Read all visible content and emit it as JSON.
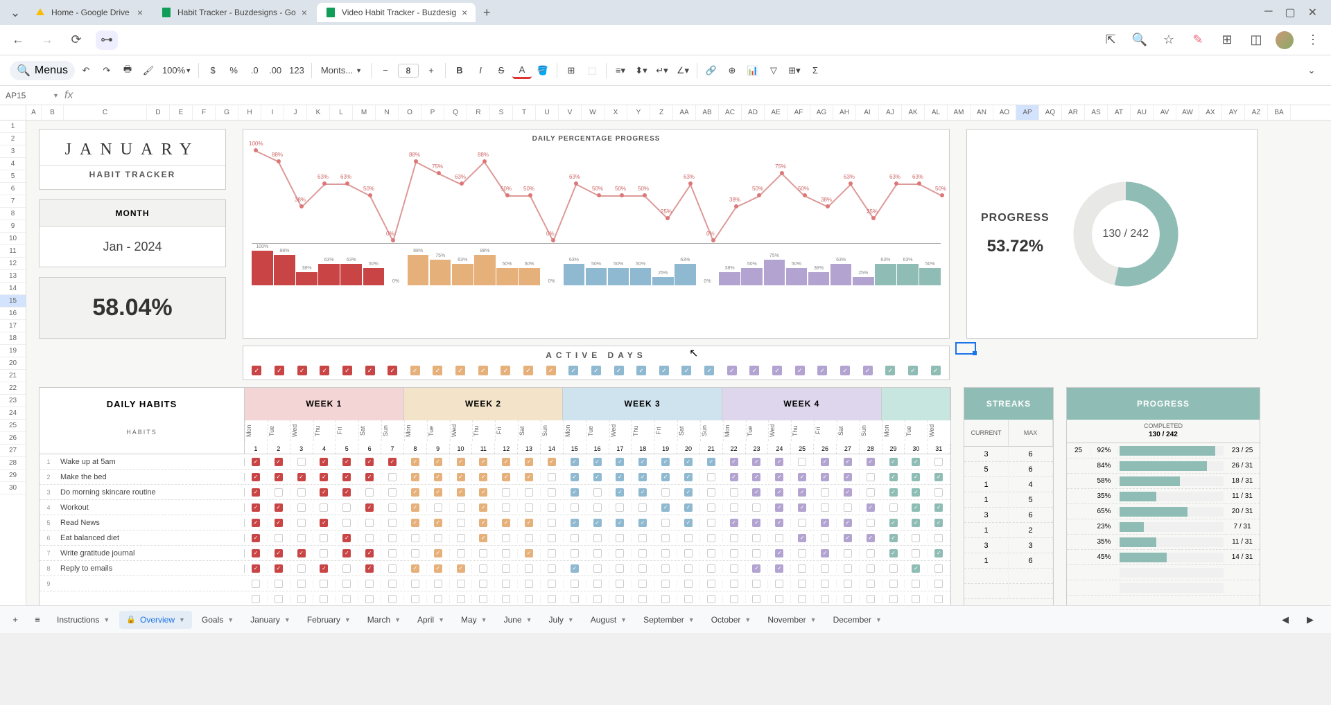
{
  "browser": {
    "tabs": [
      {
        "title": "Home - Google Drive",
        "icon": "drive"
      },
      {
        "title": "Habit Tracker - Buzdesigns - Go",
        "icon": "sheets"
      },
      {
        "title": "Video Habit Tracker - Buzdesig",
        "icon": "sheets",
        "active": true
      }
    ]
  },
  "toolbar": {
    "menus_label": "Menus",
    "zoom": "100%",
    "font": "Monts...",
    "font_size": "8",
    "formats": [
      "$",
      "%",
      ".0",
      ".00",
      "123"
    ]
  },
  "formula_bar": {
    "cell_ref": "AP15",
    "fx": "fx"
  },
  "columns": [
    "A",
    "B",
    "C",
    "D",
    "E",
    "F",
    "G",
    "H",
    "I",
    "J",
    "K",
    "L",
    "M",
    "N",
    "O",
    "P",
    "Q",
    "R",
    "S",
    "T",
    "U",
    "V",
    "W",
    "X",
    "Y",
    "Z",
    "AA",
    "AB",
    "AC",
    "AD",
    "AE",
    "AF",
    "AG",
    "AH",
    "AI",
    "AJ",
    "AK",
    "AL",
    "AM",
    "AN",
    "AO",
    "AP",
    "AQ",
    "AR",
    "AS",
    "AT",
    "AU",
    "AV",
    "AW",
    "AX",
    "AY",
    "AZ",
    "BA"
  ],
  "rows_count": 30,
  "selected_row": 15,
  "selected_col": "AP",
  "month_card": {
    "title": "JANUARY",
    "subtitle": "HABIT TRACKER"
  },
  "month_select": {
    "label": "MONTH",
    "value": "Jan  -  2024"
  },
  "month_pct": "58.04%",
  "chart_data": {
    "type": "line+bar",
    "title": "DAILY PERCENTAGE PROGRESS",
    "series": [
      {
        "name": "daily_pct",
        "values": [
          100,
          88,
          38,
          63,
          63,
          50,
          0,
          88,
          75,
          63,
          88,
          50,
          50,
          0,
          63,
          50,
          50,
          50,
          25,
          63,
          0,
          38,
          50,
          75,
          50,
          38,
          63,
          25,
          63,
          63,
          50
        ]
      }
    ],
    "week_colors": [
      "#c94545",
      "#e6b07a",
      "#8fb8d1",
      "#b3a3d1",
      "#8fbdb5"
    ]
  },
  "progress_card": {
    "label": "PROGRESS",
    "pct": "53.72%",
    "fraction": "130 / 242",
    "donut_pct": 53.72
  },
  "active_days": {
    "title": "ACTIVE DAYS",
    "count": 31
  },
  "habits_table": {
    "title": "DAILY HABITS",
    "habits_label": "HABITS",
    "weeks": [
      "WEEK 1",
      "WEEK 2",
      "WEEK 3",
      "WEEK 4",
      ""
    ],
    "days": [
      "Mon",
      "Tue",
      "Wed",
      "Thu",
      "Fri",
      "Sat",
      "Sun",
      "Mon",
      "Tue",
      "Wed",
      "Thu",
      "Fri",
      "Sat",
      "Sun",
      "Mon",
      "Tue",
      "Wed",
      "Thu",
      "Fri",
      "Sat",
      "Sun",
      "Mon",
      "Tue",
      "Wed",
      "Thu",
      "Fri",
      "Sat",
      "Sun",
      "Mon",
      "Tue",
      "Wed"
    ],
    "nums": [
      1,
      2,
      3,
      4,
      5,
      6,
      7,
      8,
      9,
      10,
      11,
      12,
      13,
      14,
      15,
      16,
      17,
      18,
      19,
      20,
      21,
      22,
      23,
      24,
      25,
      26,
      27,
      28,
      29,
      30,
      31
    ],
    "habits": [
      {
        "idx": 1,
        "name": "Wake up at 5am",
        "checks": [
          1,
          1,
          0,
          1,
          1,
          1,
          1,
          1,
          1,
          1,
          1,
          1,
          1,
          1,
          1,
          1,
          1,
          1,
          1,
          1,
          1,
          1,
          1,
          1,
          0,
          1,
          1,
          1,
          1,
          1,
          0
        ]
      },
      {
        "idx": 2,
        "name": "Make the bed",
        "checks": [
          1,
          1,
          1,
          1,
          1,
          1,
          0,
          1,
          1,
          1,
          1,
          1,
          1,
          0,
          1,
          1,
          1,
          1,
          1,
          1,
          0,
          1,
          1,
          1,
          1,
          1,
          1,
          0,
          1,
          1,
          1
        ]
      },
      {
        "idx": 3,
        "name": "Do morning skincare routine",
        "checks": [
          1,
          0,
          0,
          1,
          1,
          0,
          0,
          1,
          1,
          1,
          1,
          0,
          0,
          0,
          1,
          0,
          1,
          1,
          0,
          1,
          0,
          0,
          1,
          1,
          1,
          0,
          1,
          0,
          1,
          1,
          0
        ]
      },
      {
        "idx": 4,
        "name": "Workout",
        "checks": [
          1,
          1,
          0,
          0,
          0,
          1,
          0,
          1,
          0,
          0,
          1,
          0,
          0,
          0,
          0,
          0,
          0,
          0,
          1,
          1,
          0,
          0,
          0,
          1,
          1,
          0,
          0,
          1,
          0,
          1,
          1
        ]
      },
      {
        "idx": 5,
        "name": "Read News",
        "checks": [
          1,
          1,
          0,
          1,
          0,
          0,
          0,
          1,
          1,
          0,
          1,
          1,
          1,
          0,
          1,
          1,
          1,
          1,
          0,
          1,
          0,
          1,
          1,
          1,
          0,
          1,
          1,
          0,
          1,
          1,
          1
        ]
      },
      {
        "idx": 6,
        "name": "Eat balanced diet",
        "checks": [
          1,
          0,
          0,
          0,
          1,
          0,
          0,
          0,
          0,
          0,
          1,
          0,
          0,
          0,
          0,
          0,
          0,
          0,
          0,
          0,
          0,
          0,
          0,
          0,
          1,
          0,
          1,
          1,
          1,
          0,
          0
        ]
      },
      {
        "idx": 7,
        "name": "Write gratitude journal",
        "checks": [
          1,
          1,
          1,
          0,
          1,
          1,
          0,
          0,
          1,
          0,
          0,
          0,
          1,
          0,
          0,
          0,
          0,
          0,
          0,
          0,
          0,
          0,
          0,
          1,
          0,
          1,
          0,
          0,
          1,
          0,
          1
        ]
      },
      {
        "idx": 8,
        "name": "Reply to emails",
        "checks": [
          1,
          1,
          0,
          1,
          0,
          1,
          0,
          1,
          1,
          1,
          0,
          0,
          0,
          0,
          1,
          0,
          0,
          0,
          0,
          0,
          0,
          0,
          1,
          1,
          0,
          0,
          0,
          0,
          0,
          1,
          0
        ]
      },
      {
        "idx": 9,
        "name": ""
      },
      {
        "idx": "",
        "name": ""
      }
    ]
  },
  "streaks": {
    "title": "STREAKS",
    "cols": [
      "CURRENT",
      "MAX"
    ],
    "rows": [
      [
        3,
        6
      ],
      [
        5,
        6
      ],
      [
        1,
        4
      ],
      [
        1,
        5
      ],
      [
        3,
        6
      ],
      [
        1,
        2
      ],
      [
        3,
        3
      ],
      [
        1,
        6
      ],
      [
        "",
        ""
      ],
      [
        "",
        ""
      ]
    ]
  },
  "pprogress": {
    "title": "PROGRESS",
    "sub": "COMPLETED",
    "total": "130 / 242",
    "rows": [
      {
        "count": 25,
        "pct": "92%",
        "bar": 92,
        "frac": "23 / 25"
      },
      {
        "count": "",
        "pct": "84%",
        "bar": 84,
        "frac": "26 / 31"
      },
      {
        "count": "",
        "pct": "58%",
        "bar": 58,
        "frac": "18 / 31"
      },
      {
        "count": "",
        "pct": "35%",
        "bar": 35,
        "frac": "11 / 31"
      },
      {
        "count": "",
        "pct": "65%",
        "bar": 65,
        "frac": "20 / 31"
      },
      {
        "count": "",
        "pct": "23%",
        "bar": 23,
        "frac": "7 / 31"
      },
      {
        "count": "",
        "pct": "35%",
        "bar": 35,
        "frac": "11 / 31"
      },
      {
        "count": "",
        "pct": "45%",
        "bar": 45,
        "frac": "14 / 31"
      },
      {
        "count": "",
        "pct": "",
        "bar": 0,
        "frac": ""
      },
      {
        "count": "",
        "pct": "",
        "bar": 0,
        "frac": ""
      }
    ]
  },
  "sheet_tabs": [
    "Instructions",
    "Overview",
    "Goals",
    "January",
    "February",
    "March",
    "April",
    "May",
    "June",
    "July",
    "August",
    "September",
    "October",
    "November",
    "December"
  ],
  "active_sheet": "Overview"
}
